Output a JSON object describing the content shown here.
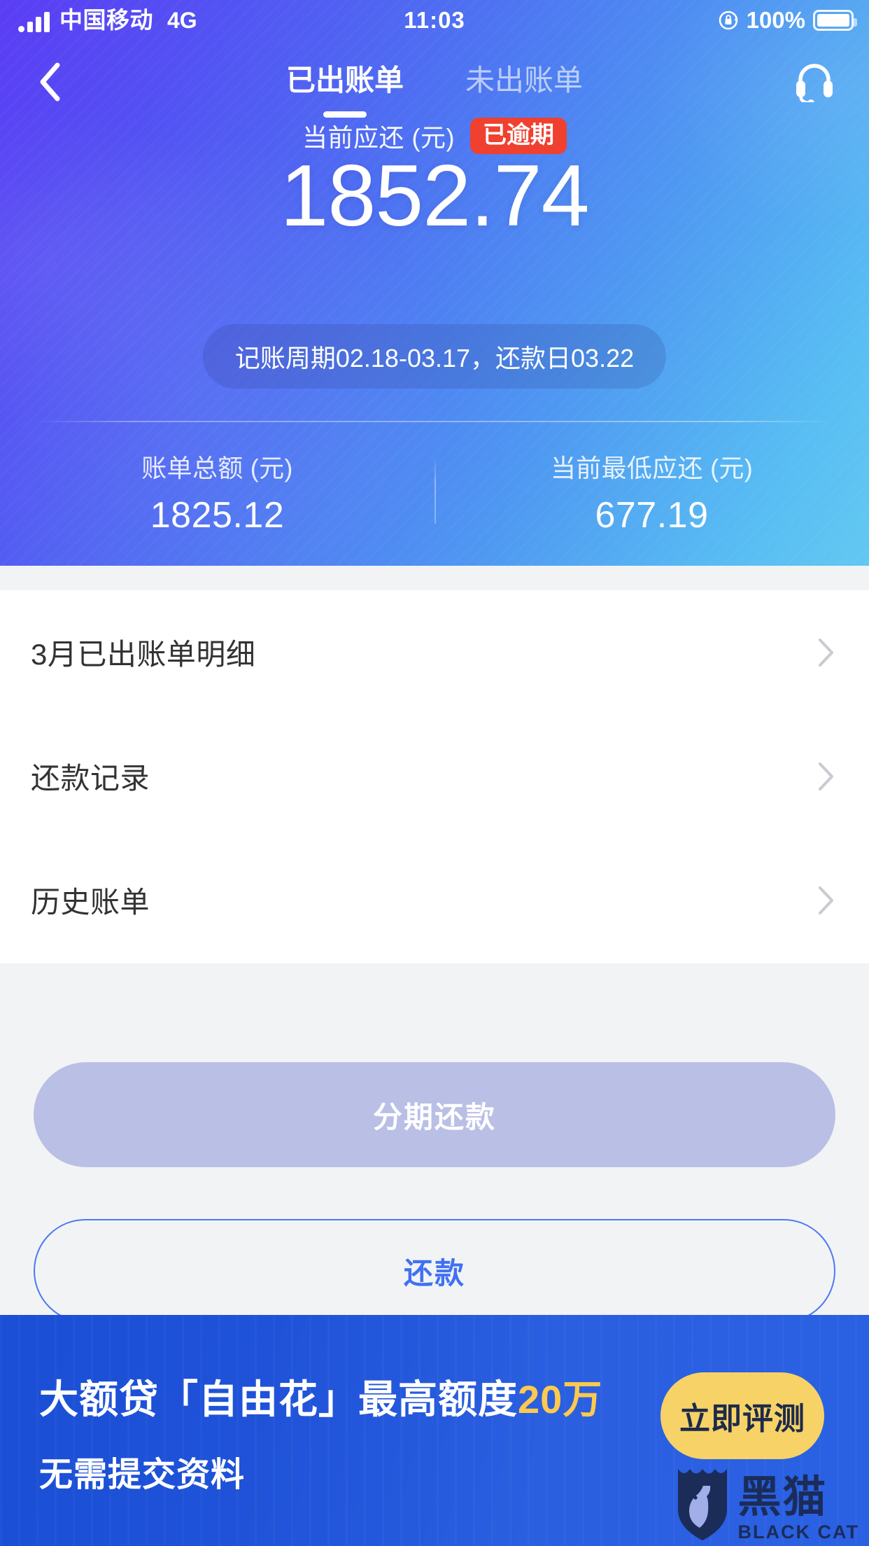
{
  "status_bar": {
    "carrier": "中国移动",
    "network": "4G",
    "time": "11:03",
    "battery_percent": "100%",
    "icons": [
      "signal-bars-icon",
      "rotation-lock-icon",
      "battery-icon"
    ]
  },
  "nav": {
    "back_icon": "chevron-left-icon",
    "service_icon": "headset-icon",
    "tabs": [
      {
        "label": "已出账单",
        "active": true
      },
      {
        "label": "未出账单",
        "active": false
      }
    ]
  },
  "hero": {
    "amount_label": "当前应还 (元)",
    "overdue_badge": "已逾期",
    "amount_value": "1852.74",
    "cycle_pill": "记账周期02.18-03.17，还款日03.22",
    "stats": [
      {
        "label": "账单总额 (元)",
        "value": "1825.12"
      },
      {
        "label": "当前最低应还 (元)",
        "value": "677.19"
      }
    ],
    "colors": {
      "gradient_start": "#5b3df4",
      "gradient_end": "#62c8f2",
      "badge_bg": "#f0402f"
    }
  },
  "list": {
    "chevron_icon": "chevron-right-icon",
    "rows": [
      {
        "label": "3月已出账单明细"
      },
      {
        "label": "还款记录"
      },
      {
        "label": "历史账单"
      }
    ]
  },
  "actions": {
    "installment_label": "分期还款",
    "installment_color": "#b9bfe5",
    "repay_label": "还款",
    "repay_color": "#4071f2"
  },
  "banner": {
    "title_prefix": "大额贷「自由花」最高额度",
    "title_highlight": "20万",
    "subtitle": "无需提交资料",
    "cta_label": "立即评测",
    "cta_color": "#f6d267",
    "bg_color": "#2a5fe0",
    "watermark": {
      "cn": "黑猫",
      "en": "BLACK CAT",
      "icon": "cat-shield-icon"
    }
  }
}
